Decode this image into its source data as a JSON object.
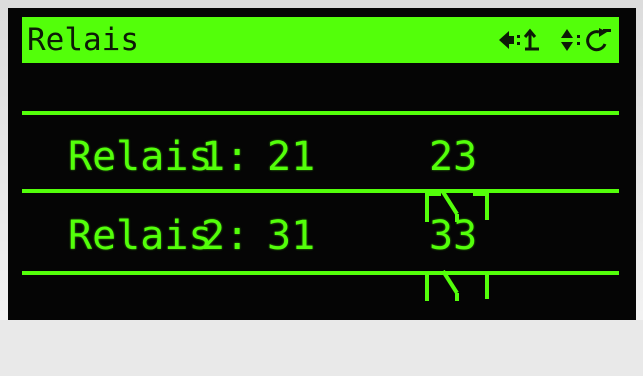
{
  "header": {
    "title": "Relais",
    "icons": [
      "speaker-back-icon",
      "up-down-refresh-icon"
    ]
  },
  "relays": [
    {
      "label": "Relais",
      "number": "1:",
      "contact_a": "21",
      "contact_symbol": "changeover-contact-icon",
      "contact_b": "23"
    },
    {
      "label": "Relais",
      "number": "2:",
      "contact_a": "31",
      "contact_symbol": "changeover-contact-icon",
      "contact_b": "33"
    }
  ],
  "colors": {
    "display_green": "#53ff0a",
    "screen_black": "#050505",
    "title_text": "#0c1a06"
  }
}
